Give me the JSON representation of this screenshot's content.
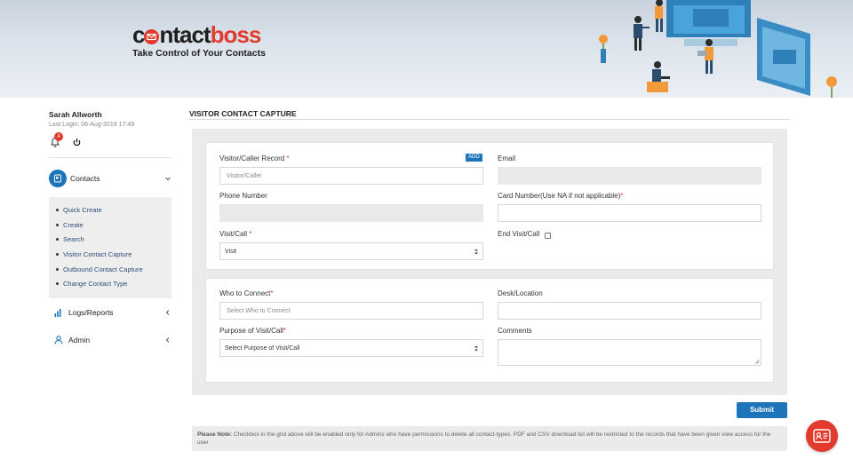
{
  "brand": {
    "logo_part1": "c",
    "logo_part2": "ntact",
    "logo_part3": "boss",
    "tagline": "Take Control of Your Contacts",
    "accent": "#e23a2d",
    "primary": "#1d74b8"
  },
  "user": {
    "name": "Sarah Allworth",
    "last_login": "Last Login: 06-Aug-2019 17:49",
    "notification_count": "4"
  },
  "sidebar": {
    "contacts_label": "Contacts",
    "contacts_items": [
      {
        "label": "Quick Create"
      },
      {
        "label": "Create"
      },
      {
        "label": "Search"
      },
      {
        "label": "Visitor Contact Capture"
      },
      {
        "label": "Outbound Contact Capture"
      },
      {
        "label": "Change Contact Type"
      }
    ],
    "logs_label": "Logs/Reports",
    "admin_label": "Admin"
  },
  "page": {
    "title": "VISITOR CONTACT CAPTURE"
  },
  "form": {
    "visitor_label": "Visitor/Caller Record",
    "visitor_placeholder": "Visitor/Caller",
    "add_label": "ADD",
    "email_label": "Email",
    "phone_label": "Phone Number",
    "card_label": "Card Number(Use NA if not applicable)",
    "visit_call_label": "Visit/Call",
    "visit_call_value": "Visit",
    "end_visit_label": "End Visit/Call",
    "who_label": "Who to Connect",
    "who_placeholder": "Select Who to Connect",
    "desk_label": "Desk/Location",
    "purpose_label": "Purpose of Visit/Call",
    "purpose_value": "Select Purpose of Visit/Call",
    "comments_label": "Comments",
    "required_mark": "*"
  },
  "actions": {
    "submit_label": "Submit"
  },
  "note": {
    "prefix": "Please Note:",
    "text": " Checkbox in the grid above will be enabled only for Admins who have permissions to delete all contact-types. PDF and CSV download list will be restricted to the records that have been given view access for the user"
  },
  "icons": {
    "bell": "bell-icon",
    "power": "power-icon",
    "contacts": "contact-card-icon",
    "logs": "bar-chart-icon",
    "admin": "user-icon",
    "fab": "id-card-icon"
  }
}
